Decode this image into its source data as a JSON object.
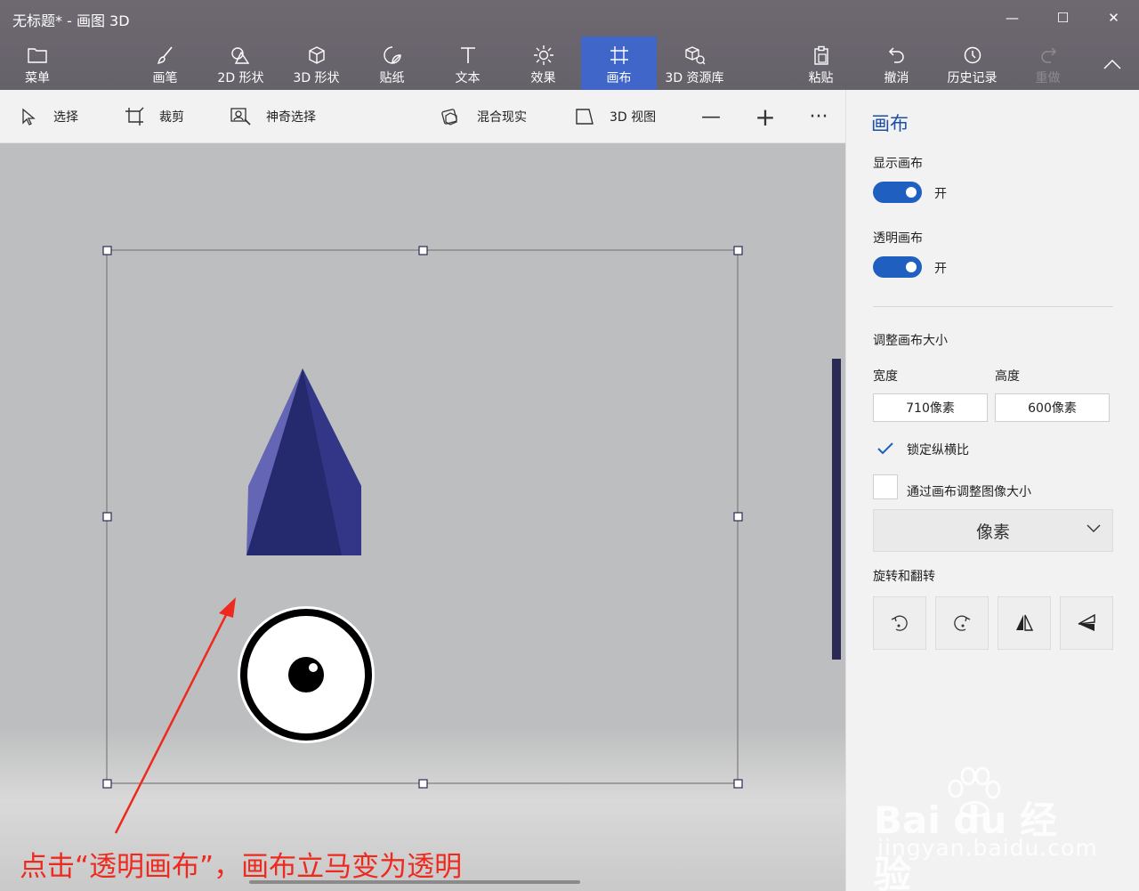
{
  "window": {
    "title": "无标题* - 画图 3D",
    "minimize_glyph": "—",
    "maximize_glyph": "☐",
    "close_glyph": "✕"
  },
  "ribbon": {
    "menu": "菜单",
    "items": [
      {
        "label": "画笔",
        "icon": "brush-icon"
      },
      {
        "label": "2D 形状",
        "icon": "2d-shapes-icon"
      },
      {
        "label": "3D 形状",
        "icon": "3d-shapes-icon"
      },
      {
        "label": "贴纸",
        "icon": "stickers-icon"
      },
      {
        "label": "文本",
        "icon": "text-icon"
      },
      {
        "label": "效果",
        "icon": "effects-icon"
      },
      {
        "label": "画布",
        "icon": "canvas-icon",
        "active": true
      },
      {
        "label": "3D 资源库",
        "icon": "3d-library-icon"
      }
    ],
    "right_items": [
      {
        "label": "粘贴",
        "icon": "paste-icon"
      },
      {
        "label": "撤消",
        "icon": "undo-icon"
      },
      {
        "label": "历史记录",
        "icon": "history-icon"
      },
      {
        "label": "重做",
        "icon": "redo-icon",
        "disabled": true
      }
    ]
  },
  "toolbar": {
    "select": "选择",
    "crop": "裁剪",
    "magic_select": "神奇选择",
    "mixed_reality": "混合现实",
    "view_3d": "3D 视图",
    "zoom_out": "—",
    "zoom_in": "+",
    "more": "···"
  },
  "panel": {
    "title": "画布",
    "show_canvas_label": "显示画布",
    "show_canvas_state": "开",
    "transparent_canvas_label": "透明画布",
    "transparent_canvas_state": "开",
    "resize_label": "调整画布大小",
    "width_label": "宽度",
    "height_label": "高度",
    "width_value": "710像素",
    "height_value": "600像素",
    "lock_aspect_label": "锁定纵横比",
    "lock_aspect_checked": true,
    "resize_image_label": "通过画布调整图像大小",
    "resize_image_checked": false,
    "unit_select": "像素",
    "rotate_flip_label": "旋转和翻转"
  },
  "canvas_objects": {
    "pyramid_color": "#25296e",
    "pyramid_light": "#6a6cba",
    "gizmo": "rotate-view-icon"
  },
  "annotation": {
    "text": "点击“透明画布”，画布立马变为透明",
    "color": "#ee2a1f"
  },
  "watermark": {
    "logo": "Bai du 经验",
    "domain": "jingyan.baidu.com"
  },
  "colors": {
    "accent": "#1f5fbf",
    "ribbon_bg": "#6a666d",
    "active_tab": "#3f66c8"
  }
}
